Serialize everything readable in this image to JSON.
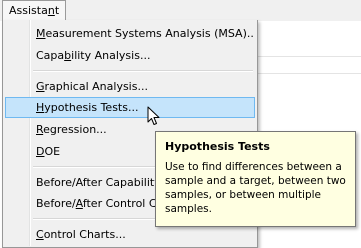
{
  "menubar": {
    "assistant": {
      "before": "Assista",
      "mnemonic": "n",
      "after": "t"
    }
  },
  "menu": {
    "items": [
      {
        "before": "",
        "mnemonic": "M",
        "after": "easurement Systems Analysis (MSA)..."
      },
      {
        "before": "Capa",
        "mnemonic": "b",
        "after": "ility Analysis..."
      },
      {
        "before": "",
        "mnemonic": "G",
        "after": "raphical Analysis..."
      },
      {
        "before": "",
        "mnemonic": "H",
        "after": "ypothesis Tests..."
      },
      {
        "before": "",
        "mnemonic": "R",
        "after": "egression..."
      },
      {
        "before": "",
        "mnemonic": "D",
        "after": "OE"
      },
      {
        "before": "Before/After Capability",
        "mnemonic": "",
        "after": ""
      },
      {
        "before": "Before/",
        "mnemonic": "A",
        "after": "fter Control C"
      },
      {
        "before": "",
        "mnemonic": "C",
        "after": "ontrol Charts..."
      }
    ]
  },
  "tooltip": {
    "title": "Hypothesis Tests",
    "body": "Use to find differences between a sample and a target, between two samples, or between multiple samples."
  },
  "colors": {
    "highlight": "#c5e4fb",
    "highlight_border": "#6fb9f1",
    "tooltip_bg": "#ffffe1"
  }
}
